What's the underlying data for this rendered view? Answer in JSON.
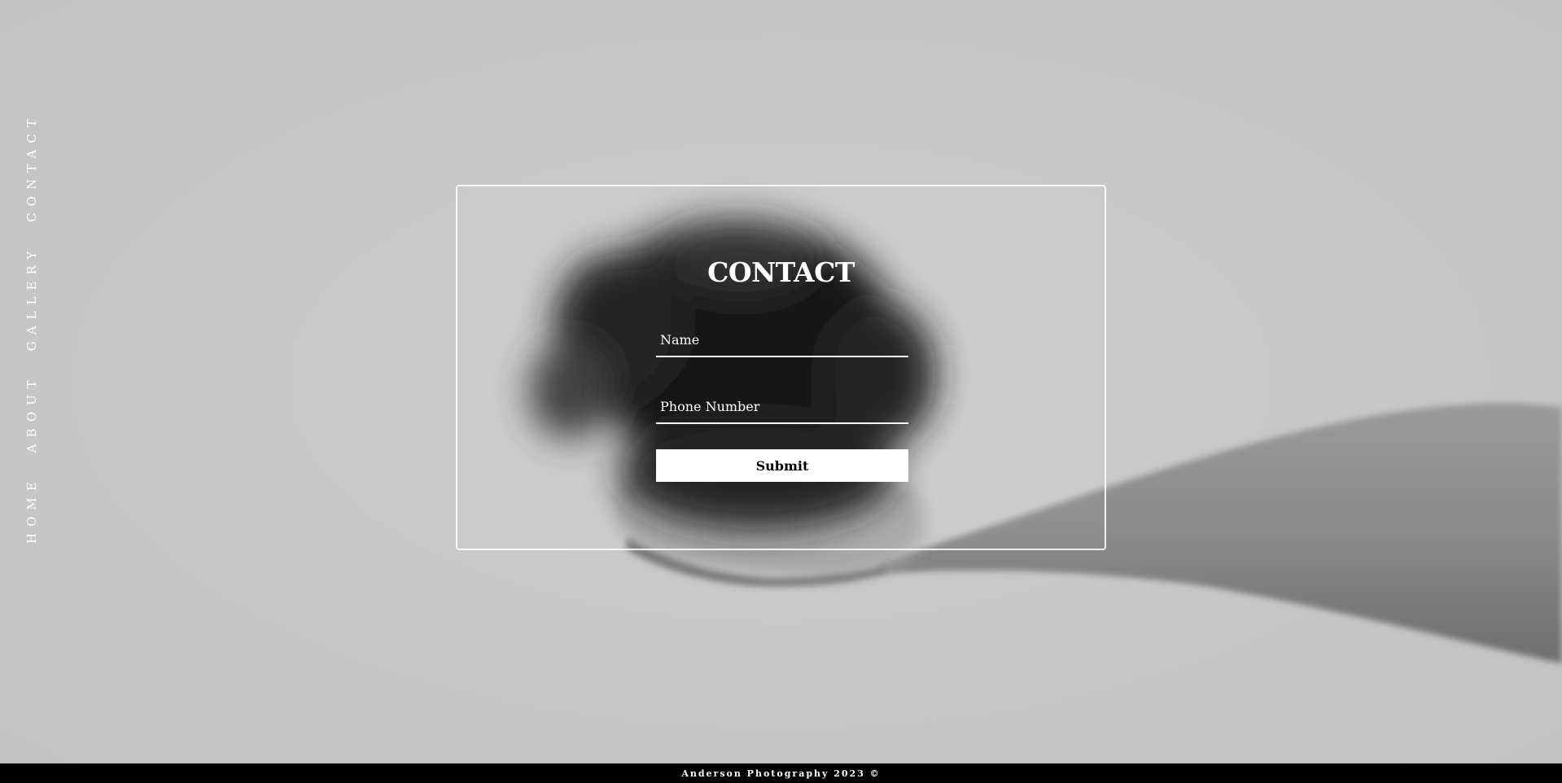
{
  "nav": {
    "items": [
      {
        "label": "HOME"
      },
      {
        "label": "ABOUT"
      },
      {
        "label": "GALLERY"
      },
      {
        "label": "CONTACT"
      }
    ]
  },
  "contact": {
    "title": "CONTACT",
    "name_placeholder": "Name",
    "phone_placeholder": "Phone Number",
    "submit_label": "Submit"
  },
  "footer": {
    "text": "Anderson Photography 2023 ©"
  },
  "colors": {
    "background": "#c9c9c9",
    "text": "#ffffff",
    "footer_bg": "#000000",
    "button_bg": "#ffffff",
    "button_text": "#000000"
  }
}
